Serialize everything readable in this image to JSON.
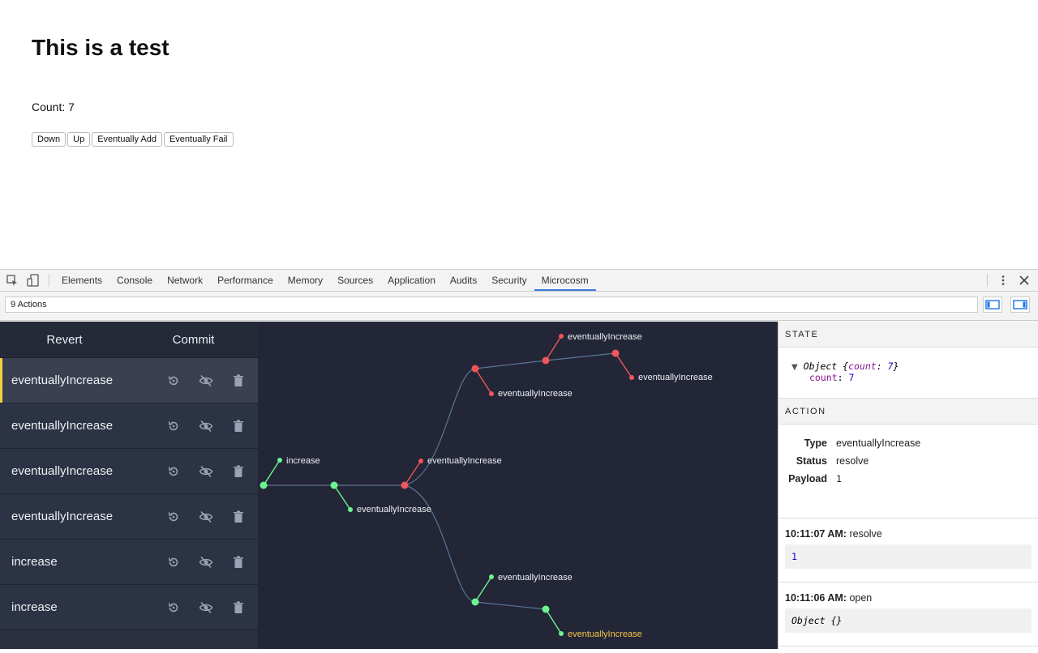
{
  "page": {
    "title": "This is a test",
    "count_label": "Count:",
    "count_value": "7",
    "buttons": [
      "Down",
      "Up",
      "Eventually Add",
      "Eventually Fail"
    ]
  },
  "devtools": {
    "tabs": [
      "Elements",
      "Console",
      "Network",
      "Performance",
      "Memory",
      "Sources",
      "Application",
      "Audits",
      "Security",
      "Microcosm"
    ],
    "active_tab": "Microcosm",
    "actions_count": "9 Actions"
  },
  "action_list": {
    "revert_label": "Revert",
    "commit_label": "Commit",
    "rows": [
      {
        "name": "eventuallyIncrease",
        "selected": true
      },
      {
        "name": "eventuallyIncrease",
        "selected": false
      },
      {
        "name": "eventuallyIncrease",
        "selected": false
      },
      {
        "name": "eventuallyIncrease",
        "selected": false
      },
      {
        "name": "increase",
        "selected": false
      },
      {
        "name": "increase",
        "selected": false
      }
    ]
  },
  "graph": {
    "labels": {
      "a": "increase",
      "b": "eventuallyIncrease",
      "c": "eventuallyIncrease",
      "d": "eventuallyIncrease",
      "e": "eventuallyIncrease",
      "f": "eventuallyIncrease",
      "g": "eventuallyIncrease",
      "h": "eventuallyIncrease"
    },
    "colors": {
      "green": "#6cf58f",
      "red": "#f0565a",
      "highlight": "#f7c548",
      "edge": "#5c7596"
    }
  },
  "side": {
    "state_heading": "STATE",
    "state_object_label": "Object",
    "state_key": "count",
    "state_value": "7",
    "action_heading": "ACTION",
    "type_label": "Type",
    "type_value": "eventuallyIncrease",
    "status_label": "Status",
    "status_value": "resolve",
    "payload_label": "Payload",
    "payload_value": "1",
    "logs": [
      {
        "time": "10:11:07 AM:",
        "event": "resolve",
        "value": "1"
      },
      {
        "time": "10:11:06 AM:",
        "event": "open",
        "value": "Object {}"
      }
    ]
  }
}
